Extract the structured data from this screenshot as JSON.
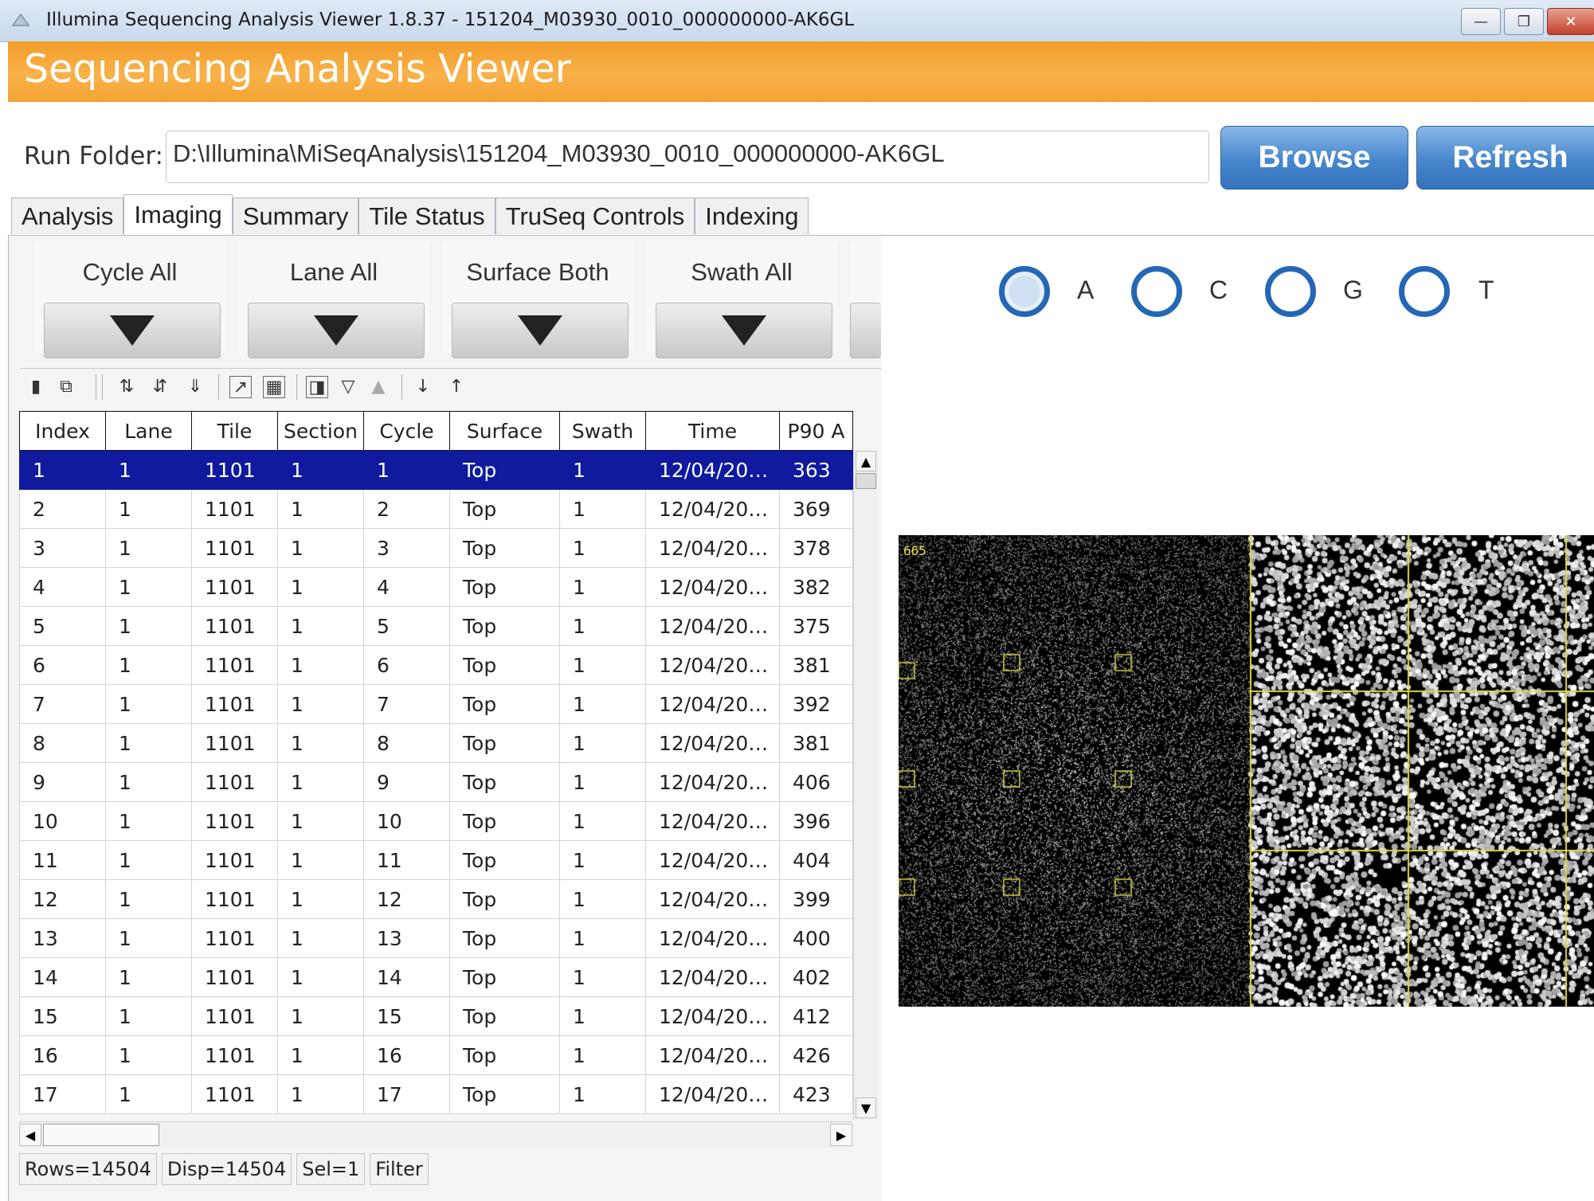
{
  "window": {
    "title": "Illumina Sequencing Analysis Viewer 1.8.37 - 151204_M03930_0010_000000000-AK6GL",
    "banner_title": "Sequencing Analysis Viewer"
  },
  "run_folder": {
    "label": "Run Folder:",
    "value": "D:\\Illumina\\MiSeqAnalysis\\151204_M03930_0010_000000000-AK6GL",
    "browse_label": "Browse",
    "refresh_label": "Refresh"
  },
  "tabs": [
    {
      "label": "Analysis"
    },
    {
      "label": "Imaging"
    },
    {
      "label": "Summary"
    },
    {
      "label": "Tile Status"
    },
    {
      "label": "TruSeq Controls"
    },
    {
      "label": "Indexing"
    }
  ],
  "active_tab": "Imaging",
  "filters": [
    {
      "label": "Cycle  All"
    },
    {
      "label": "Lane  All"
    },
    {
      "label": "Surface  Both"
    },
    {
      "label": "Swath  All"
    }
  ],
  "toolbar_icons": [
    "save-icon",
    "copy-icon",
    "sort-ascending-icon",
    "sort-descending-icon",
    "sort-custom-icon",
    "chart-icon",
    "columns-icon",
    "freeze-icon",
    "filter-icon",
    "clear-filter-icon",
    "arrow-down-icon",
    "arrow-up-icon"
  ],
  "table": {
    "columns": [
      "Index",
      "Lane",
      "Tile",
      "Section",
      "Cycle",
      "Surface",
      "Swath",
      "Time",
      "P90 A"
    ],
    "rows": [
      [
        "1",
        "1",
        "1101",
        "1",
        "1",
        "Top",
        "1",
        "12/04/201...",
        "363"
      ],
      [
        "2",
        "1",
        "1101",
        "1",
        "2",
        "Top",
        "1",
        "12/04/201...",
        "369"
      ],
      [
        "3",
        "1",
        "1101",
        "1",
        "3",
        "Top",
        "1",
        "12/04/201...",
        "378"
      ],
      [
        "4",
        "1",
        "1101",
        "1",
        "4",
        "Top",
        "1",
        "12/04/201...",
        "382"
      ],
      [
        "5",
        "1",
        "1101",
        "1",
        "5",
        "Top",
        "1",
        "12/04/201...",
        "375"
      ],
      [
        "6",
        "1",
        "1101",
        "1",
        "6",
        "Top",
        "1",
        "12/04/201...",
        "381"
      ],
      [
        "7",
        "1",
        "1101",
        "1",
        "7",
        "Top",
        "1",
        "12/04/201...",
        "392"
      ],
      [
        "8",
        "1",
        "1101",
        "1",
        "8",
        "Top",
        "1",
        "12/04/201...",
        "381"
      ],
      [
        "9",
        "1",
        "1101",
        "1",
        "9",
        "Top",
        "1",
        "12/04/201...",
        "406"
      ],
      [
        "10",
        "1",
        "1101",
        "1",
        "10",
        "Top",
        "1",
        "12/04/201...",
        "396"
      ],
      [
        "11",
        "1",
        "1101",
        "1",
        "11",
        "Top",
        "1",
        "12/04/201...",
        "404"
      ],
      [
        "12",
        "1",
        "1101",
        "1",
        "12",
        "Top",
        "1",
        "12/04/201...",
        "399"
      ],
      [
        "13",
        "1",
        "1101",
        "1",
        "13",
        "Top",
        "1",
        "12/04/201...",
        "400"
      ],
      [
        "14",
        "1",
        "1101",
        "1",
        "14",
        "Top",
        "1",
        "12/04/201...",
        "402"
      ],
      [
        "15",
        "1",
        "1101",
        "1",
        "15",
        "Top",
        "1",
        "12/04/201...",
        "412"
      ],
      [
        "16",
        "1",
        "1101",
        "1",
        "16",
        "Top",
        "1",
        "12/04/201...",
        "426"
      ],
      [
        "17",
        "1",
        "1101",
        "1",
        "17",
        "Top",
        "1",
        "12/04/201...",
        "423"
      ]
    ],
    "selected_row_index": 0
  },
  "status_bar": {
    "rows": "Rows=14504",
    "disp": "Disp=14504",
    "sel": "Sel=1",
    "filter": "Filter"
  },
  "bases": [
    {
      "label": "A",
      "checked": true
    },
    {
      "label": "C",
      "checked": false
    },
    {
      "label": "G",
      "checked": false
    },
    {
      "label": "T",
      "checked": false
    }
  ],
  "image": {
    "overlay_text": "665"
  },
  "colors": {
    "banner_orange": "#f6a83a",
    "accent_blue": "#3c7ccb",
    "selection": "#0f1a9e",
    "overlay_yellow": "#d9d94a"
  }
}
